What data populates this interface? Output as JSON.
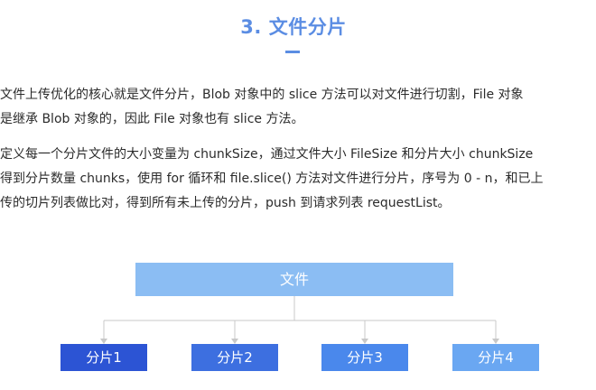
{
  "heading": {
    "title": "3. 文件分片"
  },
  "paragraphs": [
    {
      "lines": [
        "文件上传优化的核心就是文件分片，Blob 对象中的 slice 方法可以对文件进行切割，File 对象",
        "是继承 Blob 对象的，因此 File 对象也有 slice 方法。"
      ]
    },
    {
      "lines": [
        "定义每一个分片文件的大小变量为 chunkSize，通过文件大小 FileSize 和分片大小 chunkSize",
        "得到分片数量 chunks，使用 for 循环和 file.slice() 方法对文件进行分片，序号为 0 - n，和已上",
        "传的切片列表做比对，得到所有未上传的分片，push 到请求列表 requestList。"
      ]
    }
  ],
  "diagram": {
    "root_label": "文件",
    "chunks": [
      "分片1",
      "分片2",
      "分片3",
      "分片4"
    ],
    "colors": {
      "root": "#8bbdf3",
      "chunk1": "#2c54d4",
      "chunk2": "#3d6fe0",
      "chunk3": "#4a88ec",
      "chunk4": "#6aa7f2",
      "connector": "#c8c8c8"
    }
  }
}
